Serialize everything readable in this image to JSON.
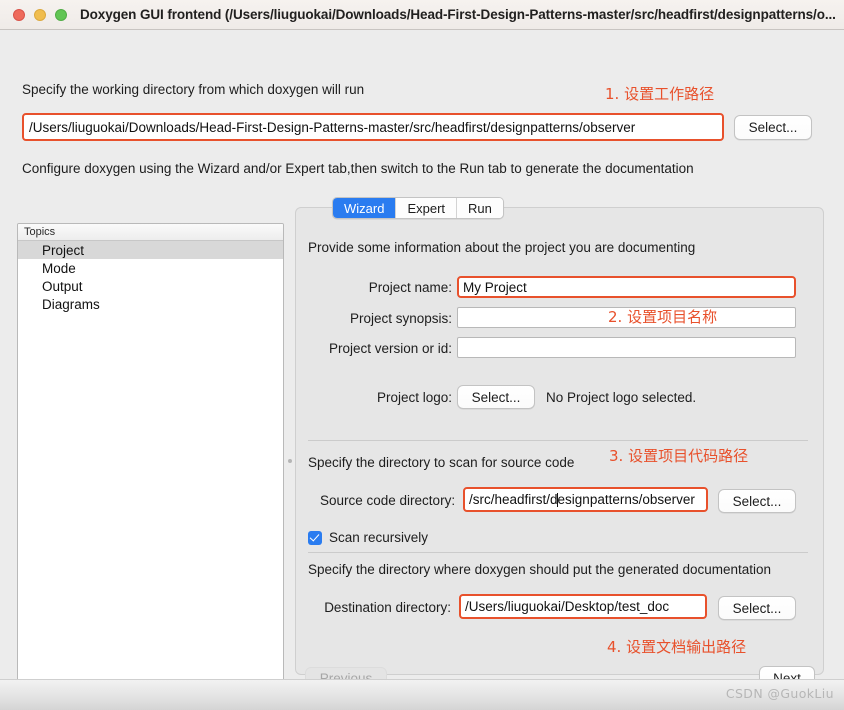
{
  "window": {
    "title": "Doxygen GUI frontend (/Users/liuguokai/Downloads/Head-First-Design-Patterns-master/src/headfirst/designpatterns/o...",
    "traffic_lights": {
      "close": "close-button",
      "minimize": "minimize-button",
      "maximize": "maximize-button"
    },
    "accent_color": "#2a7cf0",
    "annotation_color": "#e8512c"
  },
  "workdir": {
    "label": "Specify the working directory from which doxygen will run",
    "value": "/Users/liuguokai/Downloads/Head-First-Design-Patterns-master/src/headfirst/designpatterns/observer",
    "select_label": "Select..."
  },
  "configure_hint": "Configure doxygen using the Wizard and/or Expert tab,then switch to the Run tab to generate the documentation",
  "tabs": [
    {
      "label": "Wizard",
      "active": true
    },
    {
      "label": "Expert",
      "active": false
    },
    {
      "label": "Run",
      "active": false
    }
  ],
  "topics": {
    "header": "Topics",
    "items": [
      {
        "label": "Project",
        "selected": true
      },
      {
        "label": "Mode",
        "selected": false
      },
      {
        "label": "Output",
        "selected": false
      },
      {
        "label": "Diagrams",
        "selected": false
      }
    ]
  },
  "wizard": {
    "intro": "Provide some information about the project you are documenting",
    "project_name": {
      "label": "Project name:",
      "value": "My Project"
    },
    "project_synopsis": {
      "label": "Project synopsis:",
      "value": ""
    },
    "project_version": {
      "label": "Project version or id:",
      "value": ""
    },
    "project_logo": {
      "label": "Project logo:",
      "select_label": "Select...",
      "status": "No Project logo selected."
    },
    "source_section": {
      "intro": "Specify the directory to scan for source code",
      "dir_label": "Source code directory:",
      "dir_value_before_caret": "/src/headfirst/d",
      "dir_value_after_caret": "esignpatterns/observer",
      "select_label": "Select...",
      "scan_recursively_label": "Scan recursively",
      "scan_recursively_checked": true
    },
    "dest_section": {
      "intro": "Specify the directory where doxygen should put the generated documentation",
      "dir_label": "Destination directory:",
      "dir_value": "/Users/liuguokai/Desktop/test_doc",
      "select_label": "Select..."
    },
    "nav": {
      "previous_label": "Previous",
      "next_label": "Next"
    }
  },
  "annotations": [
    {
      "id": "anno1",
      "text": "1. 设置工作路径"
    },
    {
      "id": "anno2",
      "text": "2. 设置项目名称"
    },
    {
      "id": "anno3",
      "text": "3. 设置项目代码路径"
    },
    {
      "id": "anno4",
      "text": "4. 设置文档输出路径"
    }
  ],
  "footer": {
    "watermark": "CSDN @GuokLiu"
  }
}
